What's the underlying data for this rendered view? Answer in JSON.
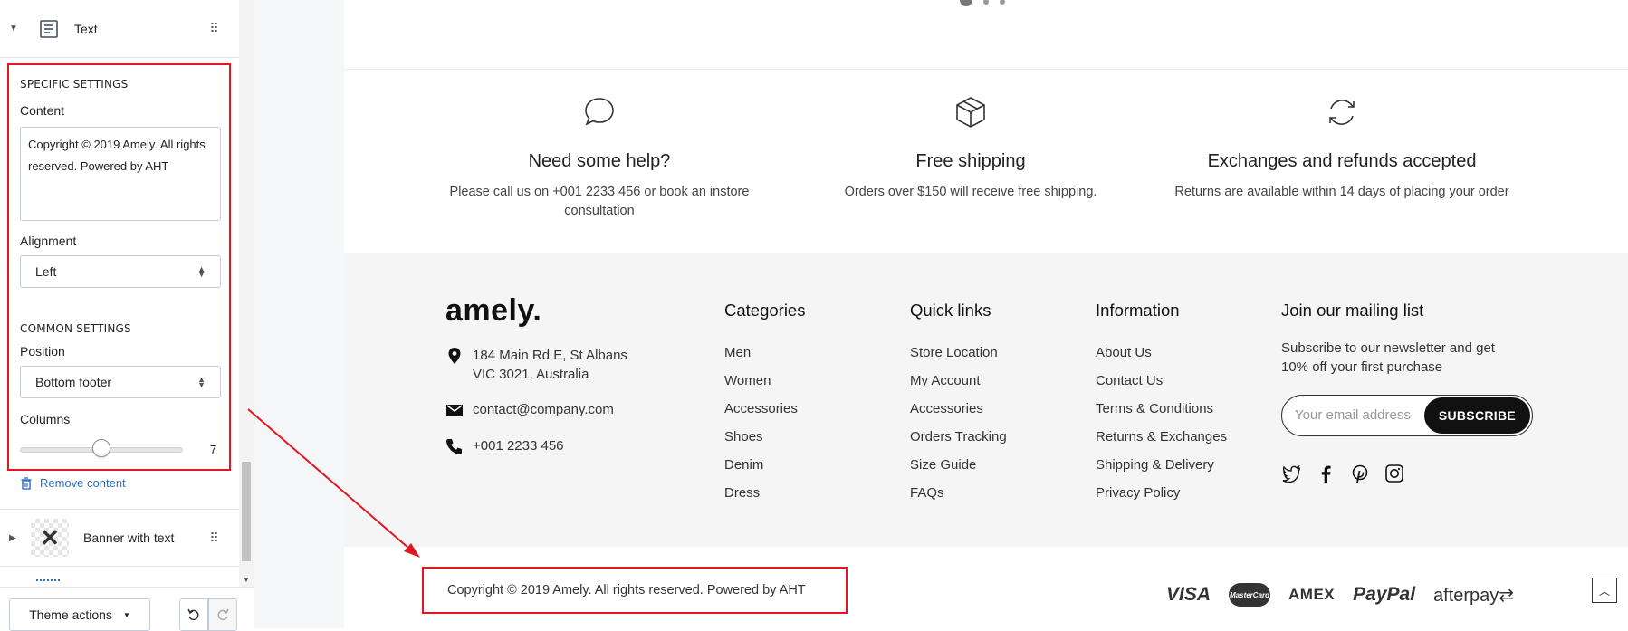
{
  "sidebar": {
    "text_block_label": "Text",
    "specific_settings_title": "SPECIFIC SETTINGS",
    "content_label": "Content",
    "content_value": "Copyright © 2019 Amely. All rights reserved. Powered by AHT",
    "alignment_label": "Alignment",
    "alignment_value": "Left",
    "common_settings_title": "COMMON SETTINGS",
    "position_label": "Position",
    "position_value": "Bottom footer",
    "columns_label": "Columns",
    "columns_value": "7",
    "columns_fraction": 0.5,
    "remove_label": "Remove content",
    "banner_label": "Banner with text",
    "theme_actions_label": "Theme actions"
  },
  "preview": {
    "features": [
      {
        "title": "Need some help?",
        "text": "Please call us on +001 2233 456 or book an instore consultation",
        "icon": "chat-bubble-icon"
      },
      {
        "title": "Free shipping",
        "text": "Orders over $150 will receive free shipping.",
        "icon": "box-icon"
      },
      {
        "title": "Exchanges and refunds accepted",
        "text": "Returns are available within 14 days of placing your order",
        "icon": "refresh-icon"
      }
    ],
    "footer": {
      "logo": "amely.",
      "address_line1": "184 Main Rd E, St Albans",
      "address_line2": "VIC 3021, Australia",
      "email": "contact@company.com",
      "phone": "+001 2233 456",
      "categories": {
        "title": "Categories",
        "items": [
          "Men",
          "Women",
          "Accessories",
          "Shoes",
          "Denim",
          "Dress"
        ]
      },
      "quick_links": {
        "title": "Quick links",
        "items": [
          "Store Location",
          "My Account",
          "Accessories",
          "Orders Tracking",
          "Size Guide",
          "FAQs"
        ]
      },
      "information": {
        "title": "Information",
        "items": [
          "About Us",
          "Contact Us",
          "Terms & Conditions",
          "Returns & Exchanges",
          "Shipping & Delivery",
          "Privacy Policy"
        ]
      },
      "mailing": {
        "title": "Join our mailing list",
        "text": "Subscribe to our newsletter and get 10% off your first purchase",
        "placeholder": "Your email address",
        "button": "SUBSCRIBE"
      }
    },
    "copyright": "Copyright © 2019 Amely. All rights reserved. Powered by AHT",
    "payments": [
      "VISA",
      "MasterCard",
      "AMEX",
      "PayPal",
      "afterpay"
    ],
    "colors": {
      "highlight": "#e0171e",
      "link": "#2c6ecb",
      "footer_bg": "#f5f5f6"
    }
  }
}
